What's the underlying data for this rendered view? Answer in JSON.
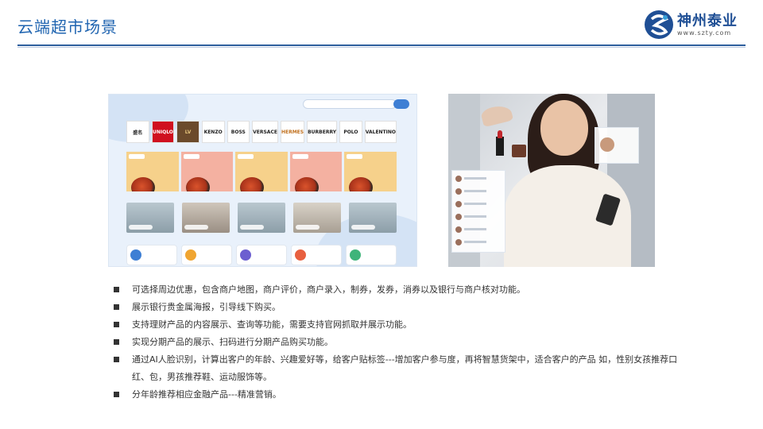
{
  "header": {
    "title": "云端超市场景",
    "logo_text": "神州泰业",
    "logo_url": "www.szty.com",
    "colors": {
      "title": "#1f64b0",
      "rule": "#2c5d9c"
    }
  },
  "bullets": [
    "可选择周边优惠，包含商户地图，商户评价，商户录入，制券，发券，消券以及银行与商户核对功能。",
    "展示银行贵金属海报，引导线下购买。",
    "支持理财产品的内容展示、查询等功能，需要支持官网抓取并展示功能。",
    "实现分期产品的展示、扫码进行分期产品购买功能。",
    "通过AI人脸识别，计算出客户的年龄、兴趣爱好等，给客户贴标签---增加客户参与度，再将智慧货架中，适合客户的产品 如，性别女孩推荐口红、包，男孩推荐鞋、运动服饰等。",
    "分年龄推荐相应金融产品---精准营销。"
  ],
  "app_mock": {
    "brands": [
      "盛名",
      "UNIQLO",
      "LV",
      "KENZO",
      "BOSS",
      "VERSACE",
      "HERMES",
      "BURBERRY",
      "POLO",
      "VALENTINO"
    ],
    "transport_icon_colors": [
      "#3e7fd4",
      "#f0a531",
      "#6c5fd0",
      "#e8603f",
      "#3fb47a"
    ]
  }
}
